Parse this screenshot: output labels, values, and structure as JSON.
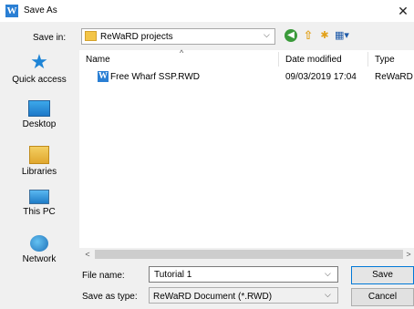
{
  "window": {
    "title": "Save As",
    "icon": "reward-app-icon",
    "icon_glyph": "W",
    "close_glyph": "✕"
  },
  "toolbar": {
    "save_in_label": "Save in:",
    "save_in_value": "ReWaRD projects",
    "save_in_icon": "folder-icon",
    "chevron": "⌵",
    "back_glyph": "◀",
    "up_glyph": "⇧",
    "new_folder_glyph": "✱",
    "views_glyph": "▦▾",
    "buttons": [
      "back-icon",
      "up-folder-icon",
      "new-folder-icon",
      "views-menu-icon"
    ]
  },
  "places": [
    {
      "label": "Quick access",
      "icon": "star-icon"
    },
    {
      "label": "Desktop",
      "icon": "desktop-icon"
    },
    {
      "label": "Libraries",
      "icon": "libraries-icon"
    },
    {
      "label": "This PC",
      "icon": "computer-icon"
    },
    {
      "label": "Network",
      "icon": "network-icon"
    }
  ],
  "file_list": {
    "columns": [
      "Name",
      "Date modified",
      "Type"
    ],
    "sort_indicator": "^",
    "rows": [
      {
        "name": "Free Wharf SSP.RWD",
        "date": "09/03/2019 17:04",
        "type": "ReWaRD"
      }
    ],
    "scroll_left": "<",
    "scroll_right": ">"
  },
  "form": {
    "file_name_label": "File name:",
    "file_name_value": "Tutorial 1",
    "save_type_label": "Save as type:",
    "save_type_value": "ReWaRD Document (*.RWD)",
    "save_label": "Save",
    "cancel_label": "Cancel"
  },
  "colors": {
    "accent": "#0078d7",
    "folder": "#f3c548",
    "panel": "#f0f0f0"
  }
}
